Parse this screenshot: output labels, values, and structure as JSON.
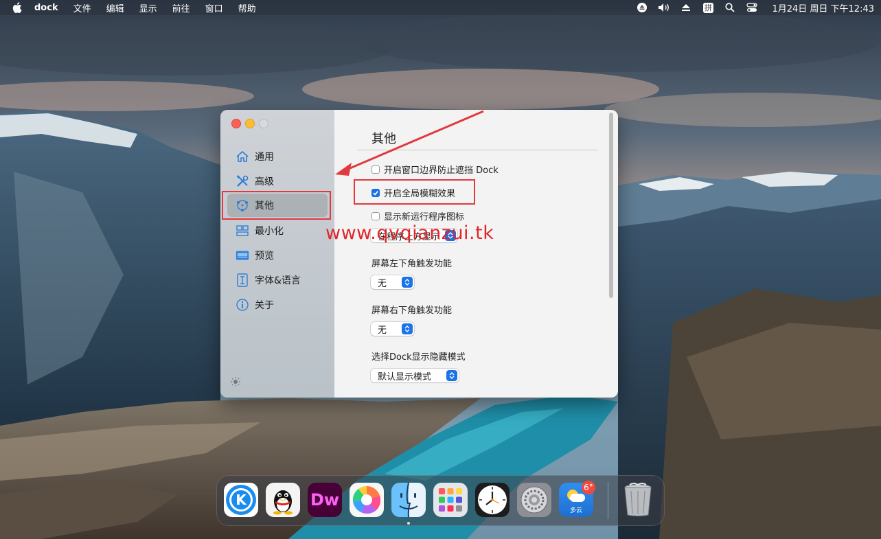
{
  "menubar": {
    "app_name": "dock",
    "menus": [
      "文件",
      "编辑",
      "显示",
      "前往",
      "窗口",
      "帮助"
    ],
    "input_method": "拼",
    "clock": "1月24日 周日 下午12:43"
  },
  "sidebar": {
    "items": [
      {
        "label": "通用",
        "icon": "home-icon"
      },
      {
        "label": "高级",
        "icon": "tools-icon"
      },
      {
        "label": "其他",
        "icon": "other-icon"
      },
      {
        "label": "最小化",
        "icon": "minimize-icon"
      },
      {
        "label": "预览",
        "icon": "preview-icon"
      },
      {
        "label": "字体&语言",
        "icon": "font-icon"
      },
      {
        "label": "关于",
        "icon": "info-icon"
      }
    ],
    "active_index": 2
  },
  "content": {
    "title": "其他",
    "options": [
      {
        "label": "开启窗口边界防止遮挡 Dock",
        "checked": false
      },
      {
        "label": "开启全局模糊效果",
        "checked": true
      },
      {
        "label": "显示新运行程序图标",
        "checked": false
      }
    ],
    "select_partial": "在程序上方显示",
    "bottom_left_label": "屏幕左下角触发功能",
    "bottom_left_value": "无",
    "bottom_right_label": "屏幕右下角触发功能",
    "bottom_right_value": "无",
    "dock_mode_label": "选择Dock显示隐藏模式",
    "dock_mode_value": "默认显示模式"
  },
  "watermark": "www.qvqianzui.tk",
  "dock": {
    "apps": [
      {
        "name": "kugou-app",
        "label": "K"
      },
      {
        "name": "qq-app",
        "label": ""
      },
      {
        "name": "dreamweaver-app",
        "label": "Dw"
      },
      {
        "name": "colorful-app",
        "label": ""
      },
      {
        "name": "finder-app",
        "label": ""
      },
      {
        "name": "launchpad-app",
        "label": ""
      },
      {
        "name": "clock-app",
        "label": ""
      },
      {
        "name": "system-preferences-app",
        "label": ""
      },
      {
        "name": "weather-app",
        "label": "多云"
      }
    ],
    "weather_badge": "6°",
    "trash": "trash"
  },
  "colors": {
    "accent": "#1a73e8",
    "annotation_red": "#e0393e"
  }
}
